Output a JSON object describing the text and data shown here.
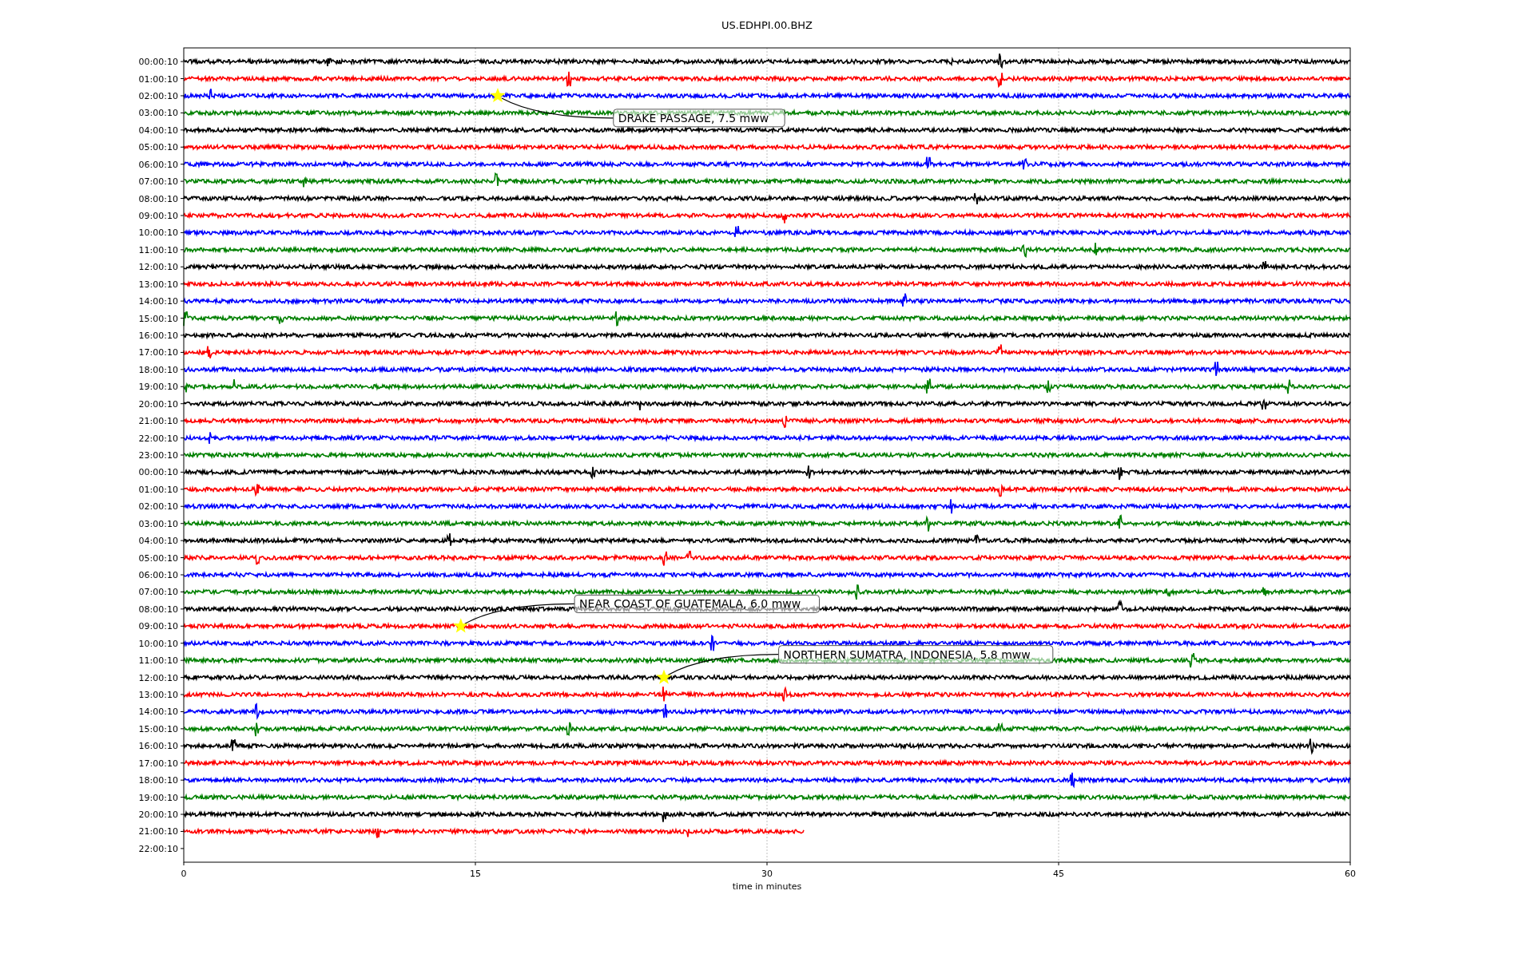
{
  "plot": {
    "title": "US.EDHPI.00.BHZ",
    "x_axis_label": "time in minutes",
    "x_ticks": [
      "0",
      "15",
      "30",
      "45",
      "60"
    ],
    "rows": [
      {
        "label": "00:00:10",
        "kind": "full",
        "color": "#000000"
      },
      {
        "label": "01:00:10",
        "kind": "full",
        "color": "#ff0000"
      },
      {
        "label": "02:00:10",
        "kind": "full",
        "color": "#0000ff",
        "event": {
          "text": "DRAKE PASSAGE, 7.5 mww"
        }
      },
      {
        "label": "03:00:10",
        "kind": "full",
        "color": "#008000"
      },
      {
        "label": "04:00:10",
        "kind": "full",
        "color": "#000000"
      },
      {
        "label": "05:00:10",
        "kind": "full",
        "color": "#ff0000"
      },
      {
        "label": "06:00:10",
        "kind": "full",
        "color": "#0000ff"
      },
      {
        "label": "07:00:10",
        "kind": "full",
        "color": "#008000"
      },
      {
        "label": "08:00:10",
        "kind": "full",
        "color": "#000000"
      },
      {
        "label": "09:00:10",
        "kind": "full",
        "color": "#ff0000"
      },
      {
        "label": "10:00:10",
        "kind": "full",
        "color": "#0000ff"
      },
      {
        "label": "11:00:10",
        "kind": "full",
        "color": "#008000"
      },
      {
        "label": "12:00:10",
        "kind": "full",
        "color": "#000000"
      },
      {
        "label": "13:00:10",
        "kind": "full",
        "color": "#ff0000"
      },
      {
        "label": "14:00:10",
        "kind": "full",
        "color": "#0000ff"
      },
      {
        "label": "15:00:10",
        "kind": "full",
        "color": "#008000"
      },
      {
        "label": "16:00:10",
        "kind": "full",
        "color": "#000000"
      },
      {
        "label": "17:00:10",
        "kind": "full",
        "color": "#ff0000"
      },
      {
        "label": "18:00:10",
        "kind": "full",
        "color": "#0000ff"
      },
      {
        "label": "19:00:10",
        "kind": "full",
        "color": "#008000"
      },
      {
        "label": "20:00:10",
        "kind": "full",
        "color": "#000000"
      },
      {
        "label": "21:00:10",
        "kind": "full",
        "color": "#ff0000"
      },
      {
        "label": "22:00:10",
        "kind": "full",
        "color": "#0000ff"
      },
      {
        "label": "23:00:10",
        "kind": "full",
        "color": "#008000"
      },
      {
        "label": "00:00:10",
        "kind": "full",
        "color": "#000000"
      },
      {
        "label": "01:00:10",
        "kind": "full",
        "color": "#ff0000"
      },
      {
        "label": "02:00:10",
        "kind": "full",
        "color": "#0000ff"
      },
      {
        "label": "03:00:10",
        "kind": "full",
        "color": "#008000"
      },
      {
        "label": "04:00:10",
        "kind": "full",
        "color": "#000000"
      },
      {
        "label": "05:00:10",
        "kind": "full",
        "color": "#ff0000"
      },
      {
        "label": "06:00:10",
        "kind": "full",
        "color": "#0000ff"
      },
      {
        "label": "07:00:10",
        "kind": "full",
        "color": "#008000"
      },
      {
        "label": "08:00:10",
        "kind": "full",
        "color": "#000000"
      },
      {
        "label": "09:00:10",
        "kind": "full",
        "color": "#ff0000",
        "event": {
          "text": "NEAR COAST OF GUATEMALA, 6.0 mww"
        }
      },
      {
        "label": "10:00:10",
        "kind": "full",
        "color": "#0000ff"
      },
      {
        "label": "11:00:10",
        "kind": "full",
        "color": "#008000"
      },
      {
        "label": "12:00:10",
        "kind": "full",
        "color": "#000000",
        "event": {
          "text": "NORTHERN SUMATRA, INDONESIA, 5.8 mww"
        }
      },
      {
        "label": "13:00:10",
        "kind": "full",
        "color": "#ff0000"
      },
      {
        "label": "14:00:10",
        "kind": "full",
        "color": "#0000ff"
      },
      {
        "label": "15:00:10",
        "kind": "full",
        "color": "#008000"
      },
      {
        "label": "16:00:10",
        "kind": "full",
        "color": "#000000"
      },
      {
        "label": "17:00:10",
        "kind": "full",
        "color": "#ff0000"
      },
      {
        "label": "18:00:10",
        "kind": "full",
        "color": "#0000ff"
      },
      {
        "label": "19:00:10",
        "kind": "full",
        "color": "#008000"
      },
      {
        "label": "20:00:10",
        "kind": "full",
        "color": "#000000"
      },
      {
        "label": "21:00:10",
        "kind": "partial",
        "color": "#ff0000"
      },
      {
        "label": "22:00:10",
        "kind": "empty"
      }
    ]
  }
}
